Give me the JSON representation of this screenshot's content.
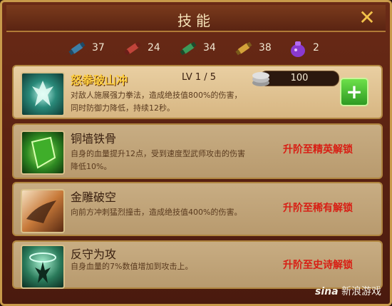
{
  "window": {
    "title": "技能"
  },
  "resources": [
    {
      "icon": "blue-scroll-icon",
      "value": "37"
    },
    {
      "icon": "red-scroll-icon",
      "value": "24"
    },
    {
      "icon": "green-scroll-icon",
      "value": "34"
    },
    {
      "icon": "gold-scroll-icon",
      "value": "38"
    },
    {
      "icon": "purple-bag-icon",
      "value": "2"
    }
  ],
  "skills": [
    {
      "name": "怒拳破山冲",
      "level": "LV 1 / 5",
      "desc": "对敌人施展强力拳法，造成绝技值800%的伤害，同时防御力降低，持续12秒。",
      "cost": "100"
    },
    {
      "name": "铜墙铁骨",
      "desc": "自身的血量提升12点，受到速度型武师攻击的伤害降低10%。",
      "unlock": "升阶至精英解锁"
    },
    {
      "name": "金雕破空",
      "desc": "向前方冲刺猛烈撞击，造成绝技值400%的伤害。",
      "unlock": "升阶至稀有解锁"
    },
    {
      "name": "反守为攻",
      "desc": "自身血量的7%数值增加到攻击上。",
      "unlock": "升阶至史诗解锁"
    }
  ],
  "watermark": {
    "logo": "sina",
    "text": "新浪游戏"
  },
  "colors": {
    "accent_gold": "#f2c24a",
    "locked_red": "#d81e14",
    "title_yellow": "#ffd040"
  }
}
